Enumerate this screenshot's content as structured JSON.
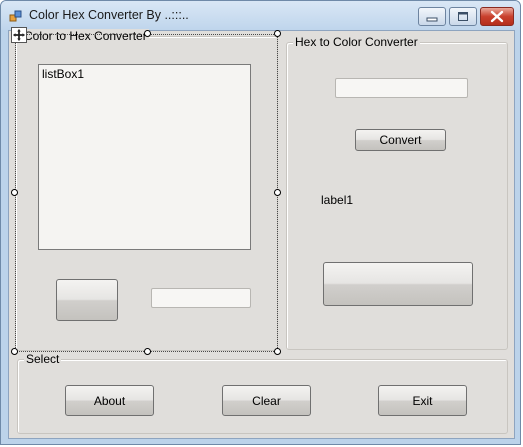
{
  "window": {
    "title": "Color Hex Converter By ..:::..",
    "controls": {
      "minimize_icon": "minimize-icon",
      "maximize_icon": "maximize-icon",
      "close_icon": "close-icon"
    }
  },
  "group_color_to_hex": {
    "label": "Color to Hex Converter",
    "listbox_text": "listBox1",
    "color_button_label": "",
    "hex_output_value": ""
  },
  "group_hex_to_color": {
    "label": "Hex to Color Converter",
    "hex_input_value": "",
    "convert_label": "Convert",
    "result_label": "label1",
    "color_preview_label": ""
  },
  "group_select": {
    "label": "Select",
    "about_label": "About",
    "clear_label": "Clear",
    "exit_label": "Exit"
  },
  "colors": {
    "client_bg": "#e0dedb",
    "title_bar": "#c9dcf0",
    "close_button": "#c9402d"
  }
}
